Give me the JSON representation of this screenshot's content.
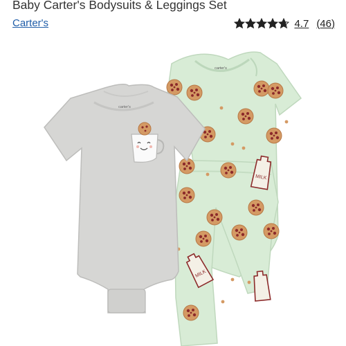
{
  "product": {
    "title": "Baby Carter's Bodysuits & Leggings Set",
    "brand": "Carter's",
    "rating": {
      "value": "4.7",
      "stars_filled": 4.7,
      "stars_total": 5,
      "review_count": "(46)"
    }
  },
  "image": {
    "gray_bodysuit_tag": "carter's",
    "green_bodysuit_tag": "carter's",
    "milk_label": "MILK"
  },
  "colors": {
    "heather_gray": "#d6d6d4",
    "mint": "#d8ecd6",
    "cookie": "#d49a64",
    "chocolate": "#8c2a2a",
    "link_blue": "#1f5da8"
  }
}
